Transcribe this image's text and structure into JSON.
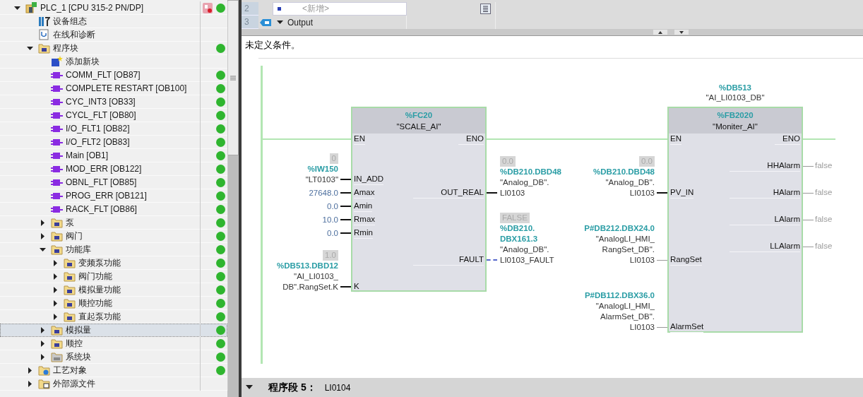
{
  "tree": [
    {
      "label": "PLC_1 [CPU 315-2 PN/DP]",
      "kind": "cpu",
      "expanded": true,
      "selected": false,
      "fault": true,
      "online": true,
      "children": [
        {
          "label": "设备组态",
          "kind": "device",
          "selected": false,
          "online": false
        },
        {
          "label": "在线和诊断",
          "kind": "diagnostics",
          "selected": false,
          "online": false
        },
        {
          "label": "程序块",
          "kind": "program",
          "expanded": true,
          "selected": false,
          "online": true,
          "children": [
            {
              "label": "添加新块",
              "kind": "add",
              "selected": false,
              "online": false
            },
            {
              "label": "COMM_FLT [OB87]",
              "kind": "ob",
              "selected": false,
              "online": true
            },
            {
              "label": "COMPLETE RESTART [OB100]",
              "kind": "ob",
              "selected": false,
              "online": true
            },
            {
              "label": "CYC_INT3 [OB33]",
              "kind": "ob",
              "selected": false,
              "online": true
            },
            {
              "label": "CYCL_FLT [OB80]",
              "kind": "ob",
              "selected": false,
              "online": true
            },
            {
              "label": "I/O_FLT1 [OB82]",
              "kind": "ob",
              "selected": false,
              "online": true
            },
            {
              "label": "I/O_FLT2 [OB83]",
              "kind": "ob",
              "selected": false,
              "online": true
            },
            {
              "label": "Main [OB1]",
              "kind": "ob",
              "selected": false,
              "online": true
            },
            {
              "label": "MOD_ERR [OB122]",
              "kind": "ob",
              "selected": false,
              "online": true
            },
            {
              "label": "OBNL_FLT [OB85]",
              "kind": "ob",
              "selected": false,
              "online": true
            },
            {
              "label": "PROG_ERR [OB121]",
              "kind": "ob",
              "selected": false,
              "online": true
            },
            {
              "label": "RACK_FLT [OB86]",
              "kind": "ob",
              "selected": false,
              "online": true
            },
            {
              "label": "泵",
              "kind": "group",
              "expanded": false,
              "selected": false,
              "online": true
            },
            {
              "label": "阀门",
              "kind": "group",
              "expanded": false,
              "selected": false,
              "online": true
            },
            {
              "label": "功能库",
              "kind": "group",
              "expanded": true,
              "selected": false,
              "online": true,
              "children": [
                {
                  "label": "变频泵功能",
                  "kind": "group",
                  "expanded": false,
                  "selected": false,
                  "online": true
                },
                {
                  "label": "阀门功能",
                  "kind": "group",
                  "expanded": false,
                  "selected": false,
                  "online": true
                },
                {
                  "label": "模拟量功能",
                  "kind": "group",
                  "expanded": false,
                  "selected": false,
                  "online": true
                },
                {
                  "label": "顺控功能",
                  "kind": "group",
                  "expanded": false,
                  "selected": false,
                  "online": true
                },
                {
                  "label": "直起泵功能",
                  "kind": "group",
                  "expanded": false,
                  "selected": false,
                  "online": true
                }
              ]
            },
            {
              "label": "模拟量",
              "kind": "group",
              "expanded": false,
              "selected": true,
              "online": true
            },
            {
              "label": "顺控",
              "kind": "group",
              "expanded": false,
              "selected": false,
              "online": true
            },
            {
              "label": "系统块",
              "kind": "system",
              "expanded": false,
              "selected": false,
              "online": true
            }
          ]
        },
        {
          "label": "工艺对象",
          "kind": "tech",
          "expanded": false,
          "selected": false,
          "online": true
        },
        {
          "label": "外部源文件",
          "kind": "source",
          "expanded": false,
          "selected": false,
          "online": false
        }
      ]
    }
  ],
  "interface": [
    {
      "number": "2",
      "kind": "new",
      "placeholder": "<新增>"
    },
    {
      "number": "3",
      "kind": "section",
      "name": "Output",
      "expanded": true
    }
  ],
  "comment": "未定义条件。",
  "blocks": [
    {
      "number": "%FC20",
      "name": "\"SCALE_AI\"",
      "en": "EN",
      "eno": "ENO",
      "inputs": [
        {
          "pin": "IN_ADD",
          "value": "0",
          "address": [
            "%IW150"
          ],
          "symbol": [
            "\"LT0103\""
          ],
          "kind": "solid"
        },
        {
          "pin": "Amax",
          "constant": "27648.0",
          "kind": "solid"
        },
        {
          "pin": "Amin",
          "constant": "0.0",
          "kind": "solid"
        },
        {
          "pin": "Rmax",
          "constant": "10.0",
          "kind": "solid"
        },
        {
          "pin": "Rmin",
          "constant": "0.0",
          "kind": "solid"
        },
        {
          "pin": "K",
          "value": "1.0",
          "address": [
            "%DB513.DBD12"
          ],
          "symbol": [
            "\"AI_LI0103_",
            "DB\".RangSet.K"
          ],
          "kind": "solid"
        }
      ],
      "outputs": [
        {
          "pin": "OUT_REAL",
          "value": "0.0",
          "address": [
            "%DB210.DBD48"
          ],
          "symbol": [
            "\"Analog_DB\".",
            "LI0103"
          ],
          "kind": "solid"
        },
        {
          "pin": "FAULT",
          "value": "FALSE",
          "address": [
            "%DB210.",
            "DBX161.3"
          ],
          "symbol": [
            "\"Analog_DB\".",
            "LI0103_FAULT"
          ],
          "kind": "dashed"
        }
      ]
    },
    {
      "instance": {
        "address": "%DB513",
        "symbol": "\"AI_LI0103_DB\""
      },
      "number": "%FB2020",
      "name": "\"Moniter_AI\"",
      "en": "EN",
      "eno": "ENO",
      "inputs": [
        {
          "pin": "PV_IN",
          "value": "0.0",
          "address": [
            "%DB210.DBD48"
          ],
          "symbol": [
            "\"Analog_DB\".",
            "LI0103"
          ],
          "kind": "solid"
        },
        {
          "pin": "RangSet",
          "address": [
            "P#DB212.DBX24.0"
          ],
          "symbol": [
            "\"AnalogLI_HMI_",
            "RangSet_DB\".",
            "LI0103"
          ],
          "kind": "thin"
        },
        {
          "pin": "AlarmSet",
          "address": [
            "P#DB112.DBX36.0"
          ],
          "symbol": [
            "\"AnalogLI_HMI_",
            "AlarmSet_DB\".",
            "LI0103"
          ],
          "kind": "thin"
        }
      ],
      "outputs": [
        {
          "pin": "HHAlarm",
          "reading": "false",
          "kind": "thin"
        },
        {
          "pin": "HAlarm",
          "reading": "false",
          "kind": "thin"
        },
        {
          "pin": "LAlarm",
          "reading": "false",
          "kind": "thin"
        },
        {
          "pin": "LLAlarm",
          "reading": "false",
          "kind": "thin"
        }
      ]
    }
  ],
  "next_network": {
    "expanded": true,
    "title": "程序段 5：",
    "comment": "LI0104"
  }
}
